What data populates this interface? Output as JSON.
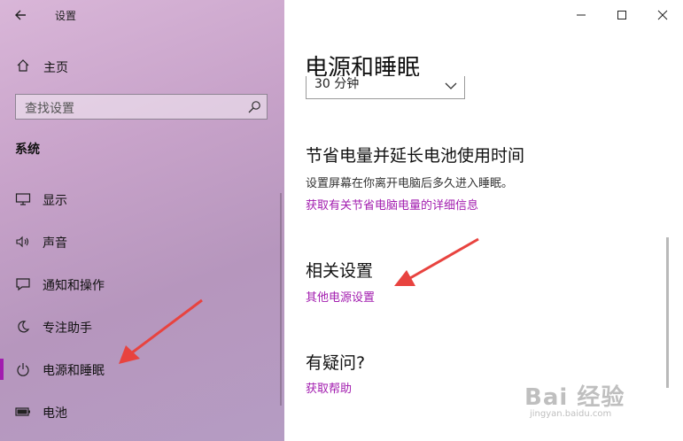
{
  "window": {
    "app_title": "设置",
    "back_icon": "back-arrow-icon",
    "controls": [
      "minimize-icon",
      "maximize-icon",
      "close-icon"
    ]
  },
  "sidebar": {
    "home_label": "主页",
    "search_placeholder": "查找设置",
    "section_title": "系统",
    "items": [
      {
        "label": "显示",
        "icon": "monitor-icon",
        "active": false
      },
      {
        "label": "声音",
        "icon": "speaker-icon",
        "active": false
      },
      {
        "label": "通知和操作",
        "icon": "message-icon",
        "active": false
      },
      {
        "label": "专注助手",
        "icon": "moon-icon",
        "active": false
      },
      {
        "label": "电源和睡眠",
        "icon": "power-icon",
        "active": true
      },
      {
        "label": "电池",
        "icon": "battery-icon",
        "active": false
      }
    ]
  },
  "main": {
    "title": "电源和睡眠",
    "sleep_dropdown_value": "30 分钟",
    "battery_section": {
      "heading": "节省电量并延长电池使用时间",
      "description": "设置屏幕在你离开电脑后多久进入睡眠。",
      "link": "获取有关节省电脑电量的详细信息"
    },
    "related_section": {
      "heading": "相关设置",
      "link": "其他电源设置"
    },
    "help_section": {
      "heading": "有疑问?",
      "link": "获取帮助"
    }
  },
  "watermark": {
    "brand": "Bai 经验",
    "url": "jingyan.baidu.com"
  },
  "colors": {
    "accent": "#a21caf",
    "annotation_arrow": "#e8433f"
  }
}
